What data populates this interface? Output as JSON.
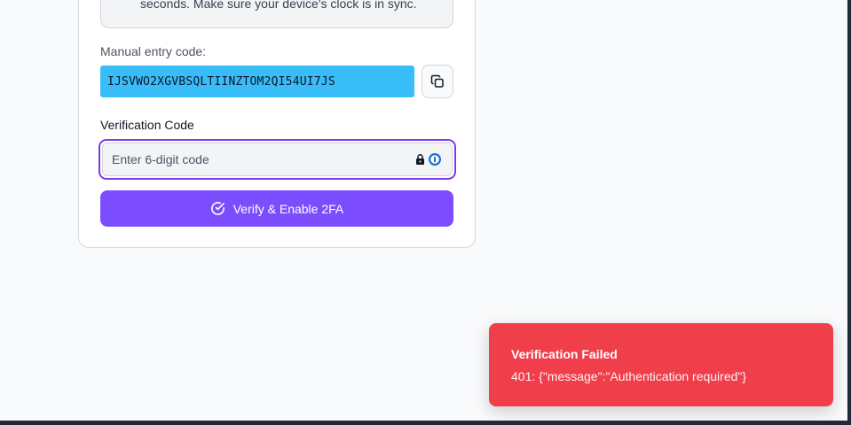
{
  "setup": {
    "info_text": "seconds. Make sure your device's clock is in sync.",
    "manual_entry_label": "Manual entry code:",
    "manual_entry_code": "IJSVWO2XGVBSQLTIINZTOM2QI54UI7JS",
    "copy_icon": "copy-icon"
  },
  "verification": {
    "label": "Verification Code",
    "placeholder": "Enter 6-digit code",
    "value": "",
    "password_manager_icons": [
      "lock-icon",
      "password-manager-icon"
    ],
    "submit_label": "Verify & Enable 2FA",
    "submit_icon": "check-circle-icon"
  },
  "toast": {
    "title": "Verification Failed",
    "message": "401: {\"message\":\"Authentication required\"}"
  },
  "colors": {
    "primary": "#7c4dff",
    "focus_ring": "#7c3aed",
    "selection": "#38bdf8",
    "error": "#f13e4b"
  }
}
